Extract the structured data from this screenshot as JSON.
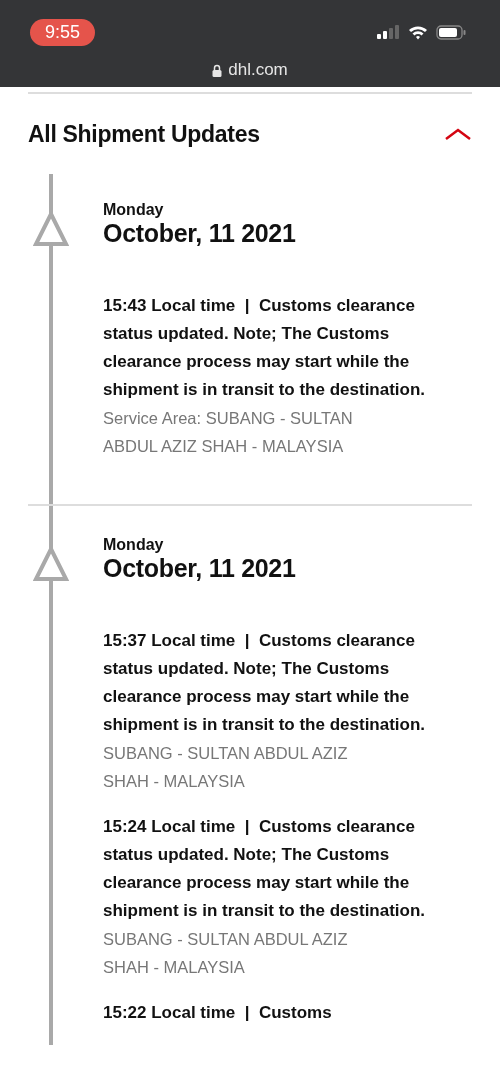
{
  "status_bar": {
    "time": "9:55"
  },
  "address_bar": {
    "url": "dhl.com",
    "secure": true
  },
  "section": {
    "title": "All Shipment Updates",
    "expanded": true
  },
  "groups": [
    {
      "day": "Monday",
      "date": "October, 11 2021",
      "events": [
        {
          "summary": "15:43 Local time  |  Customs clearance status updated. Note; The Customs clearance process may start while the shipment is in transit to the destination.",
          "location": "Service Area: SUBANG - SULTAN ABDUL AZIZ SHAH - MALAYSIA"
        }
      ]
    },
    {
      "day": "Monday",
      "date": "October, 11 2021",
      "events": [
        {
          "summary": "15:37 Local time  |  Customs clearance status updated. Note; The Customs clearance process may start while the shipment is in transit to the destination.",
          "location": "SUBANG - SULTAN ABDUL AZIZ SHAH - MALAYSIA"
        },
        {
          "summary": "15:24 Local time  |  Customs clearance status updated. Note; The Customs clearance process may start while the shipment is in transit to the destination.",
          "location": "SUBANG - SULTAN ABDUL AZIZ SHAH - MALAYSIA"
        },
        {
          "summary": "15:22 Local time  |  Customs"
        }
      ]
    }
  ]
}
